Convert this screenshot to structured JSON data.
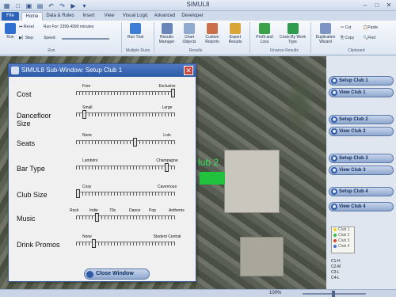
{
  "app": {
    "title": "SIMUL8"
  },
  "tabs": [
    {
      "label": "File"
    },
    {
      "label": "Home"
    },
    {
      "label": "Data & Rules"
    },
    {
      "label": "Insert"
    },
    {
      "label": "View"
    },
    {
      "label": "Visual Logic"
    },
    {
      "label": "Advanced"
    },
    {
      "label": "Developer"
    }
  ],
  "ribbon": {
    "run_label": "Run",
    "reset_label": "Reset",
    "step_label": "Step",
    "speed_label": "Speed:",
    "run_for": "Run For: 2399.4999 minutes",
    "run_trial_label": "Run Trial",
    "results_manager_label": "Results Manager",
    "chart_objects_label": "Chart Objects",
    "custom_reports_label": "Custom Reports",
    "export_results_label": "Export Results",
    "profit_loss_label": "Profit and Loss",
    "costs_label": "Costs By Work Type",
    "duplication_wizard_label": "Duplication Wizard",
    "cut_label": "Cut",
    "paste_label": "Paste",
    "copy_label": "Copy",
    "find_label": "Find",
    "groups": [
      "Run",
      "Multiple Runs",
      "Results",
      "Finance Results",
      "Clipboard"
    ]
  },
  "map": {
    "label": "lub 2"
  },
  "subwindow": {
    "title": "SIMUL8 Sub-Window: Setup Club 1",
    "close_label": "Close Window",
    "rows": [
      {
        "label": "Cost",
        "ticks": [
          "Free",
          "Exclusive"
        ],
        "level": 1.0
      },
      {
        "label": "Dancefloor Size",
        "ticks": [
          "Small",
          "Large"
        ],
        "level": 0.07
      },
      {
        "label": "Seats",
        "ticks": [
          "None",
          "Lots"
        ],
        "level": 0.6
      },
      {
        "label": "Bar Type",
        "ticks": [
          "Lambrini",
          "Champagne"
        ],
        "level": 0.93
      },
      {
        "label": "Club Size",
        "ticks": [
          "Cosy",
          "Cavernous"
        ],
        "level": 0.0
      },
      {
        "label": "Music",
        "ticks": [
          "Rock",
          "Indie",
          "70s",
          "Dance",
          "Pop",
          "Anthems"
        ],
        "level": 0.2
      },
      {
        "label": "Drink Promos",
        "ticks": [
          "None",
          "Student Central"
        ],
        "level": 0.17
      }
    ]
  },
  "right_panel": {
    "buttons": [
      {
        "label": "Setup Club 1"
      },
      {
        "label": "View Club 1"
      },
      {
        "label": "Setup Club 2"
      },
      {
        "label": "View Club 2"
      },
      {
        "label": "Setup Club 3"
      },
      {
        "label": "View Club 3"
      },
      {
        "label": "Setup Club 4"
      },
      {
        "label": "View Club 4"
      }
    ],
    "legend": [
      {
        "label": "Club 1",
        "color": "#f2d21b"
      },
      {
        "label": "Club 2",
        "color": "#2bbf3a"
      },
      {
        "label": "Club 3",
        "color": "#e0402a"
      },
      {
        "label": "Club 4",
        "color": "#3b6fd8"
      }
    ],
    "codes": [
      "C1-H",
      "C2-M",
      "C3-L",
      "C4-L"
    ]
  },
  "status": {
    "zoom": "100%"
  }
}
